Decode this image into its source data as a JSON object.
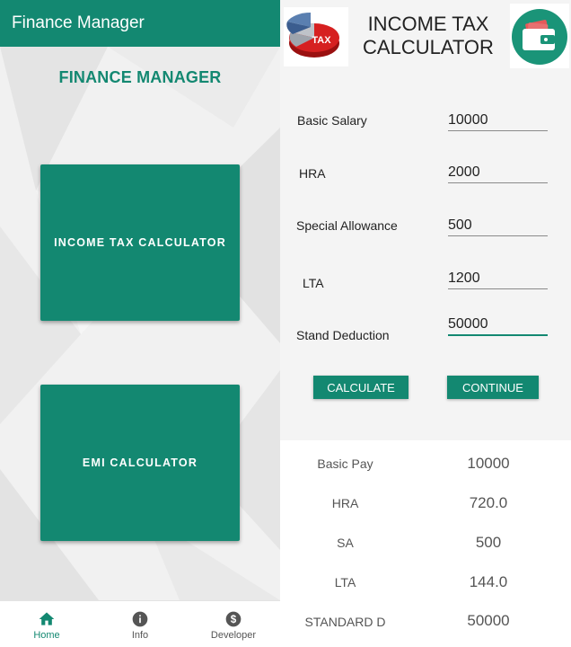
{
  "home": {
    "appbar_title": "Finance Manager",
    "heading": "FINANCE MANAGER",
    "tax_button": "INCOME TAX CALCULATOR",
    "emi_button": "EMI CALCULATOR",
    "nav": {
      "home": "Home",
      "info": "Info",
      "developer": "Developer"
    },
    "accent_color": "#138871"
  },
  "calculator": {
    "title_line1": "INCOME TAX",
    "title_line2": "CALCULATOR",
    "logo_text": "TAX",
    "fields": {
      "basic_salary": {
        "label": "Basic Salary",
        "value": "10000"
      },
      "hra": {
        "label": "HRA",
        "value": "2000"
      },
      "special_allowance": {
        "label": "Special Allowance",
        "value": "500"
      },
      "lta": {
        "label": "LTA",
        "value": "1200"
      },
      "stand_deduction": {
        "label": "Stand Deduction",
        "value": "50000"
      }
    },
    "calculate_label": "CALCULATE",
    "continue_label": "CONTINUE",
    "results": {
      "basic_pay": {
        "label": "Basic Pay",
        "value": "10000"
      },
      "hra": {
        "label": "HRA",
        "value": "720.0"
      },
      "sa": {
        "label": "SA",
        "value": "500"
      },
      "lta": {
        "label": "LTA",
        "value": "144.0"
      },
      "standard_d": {
        "label": "STANDARD D",
        "value": "50000"
      }
    }
  }
}
